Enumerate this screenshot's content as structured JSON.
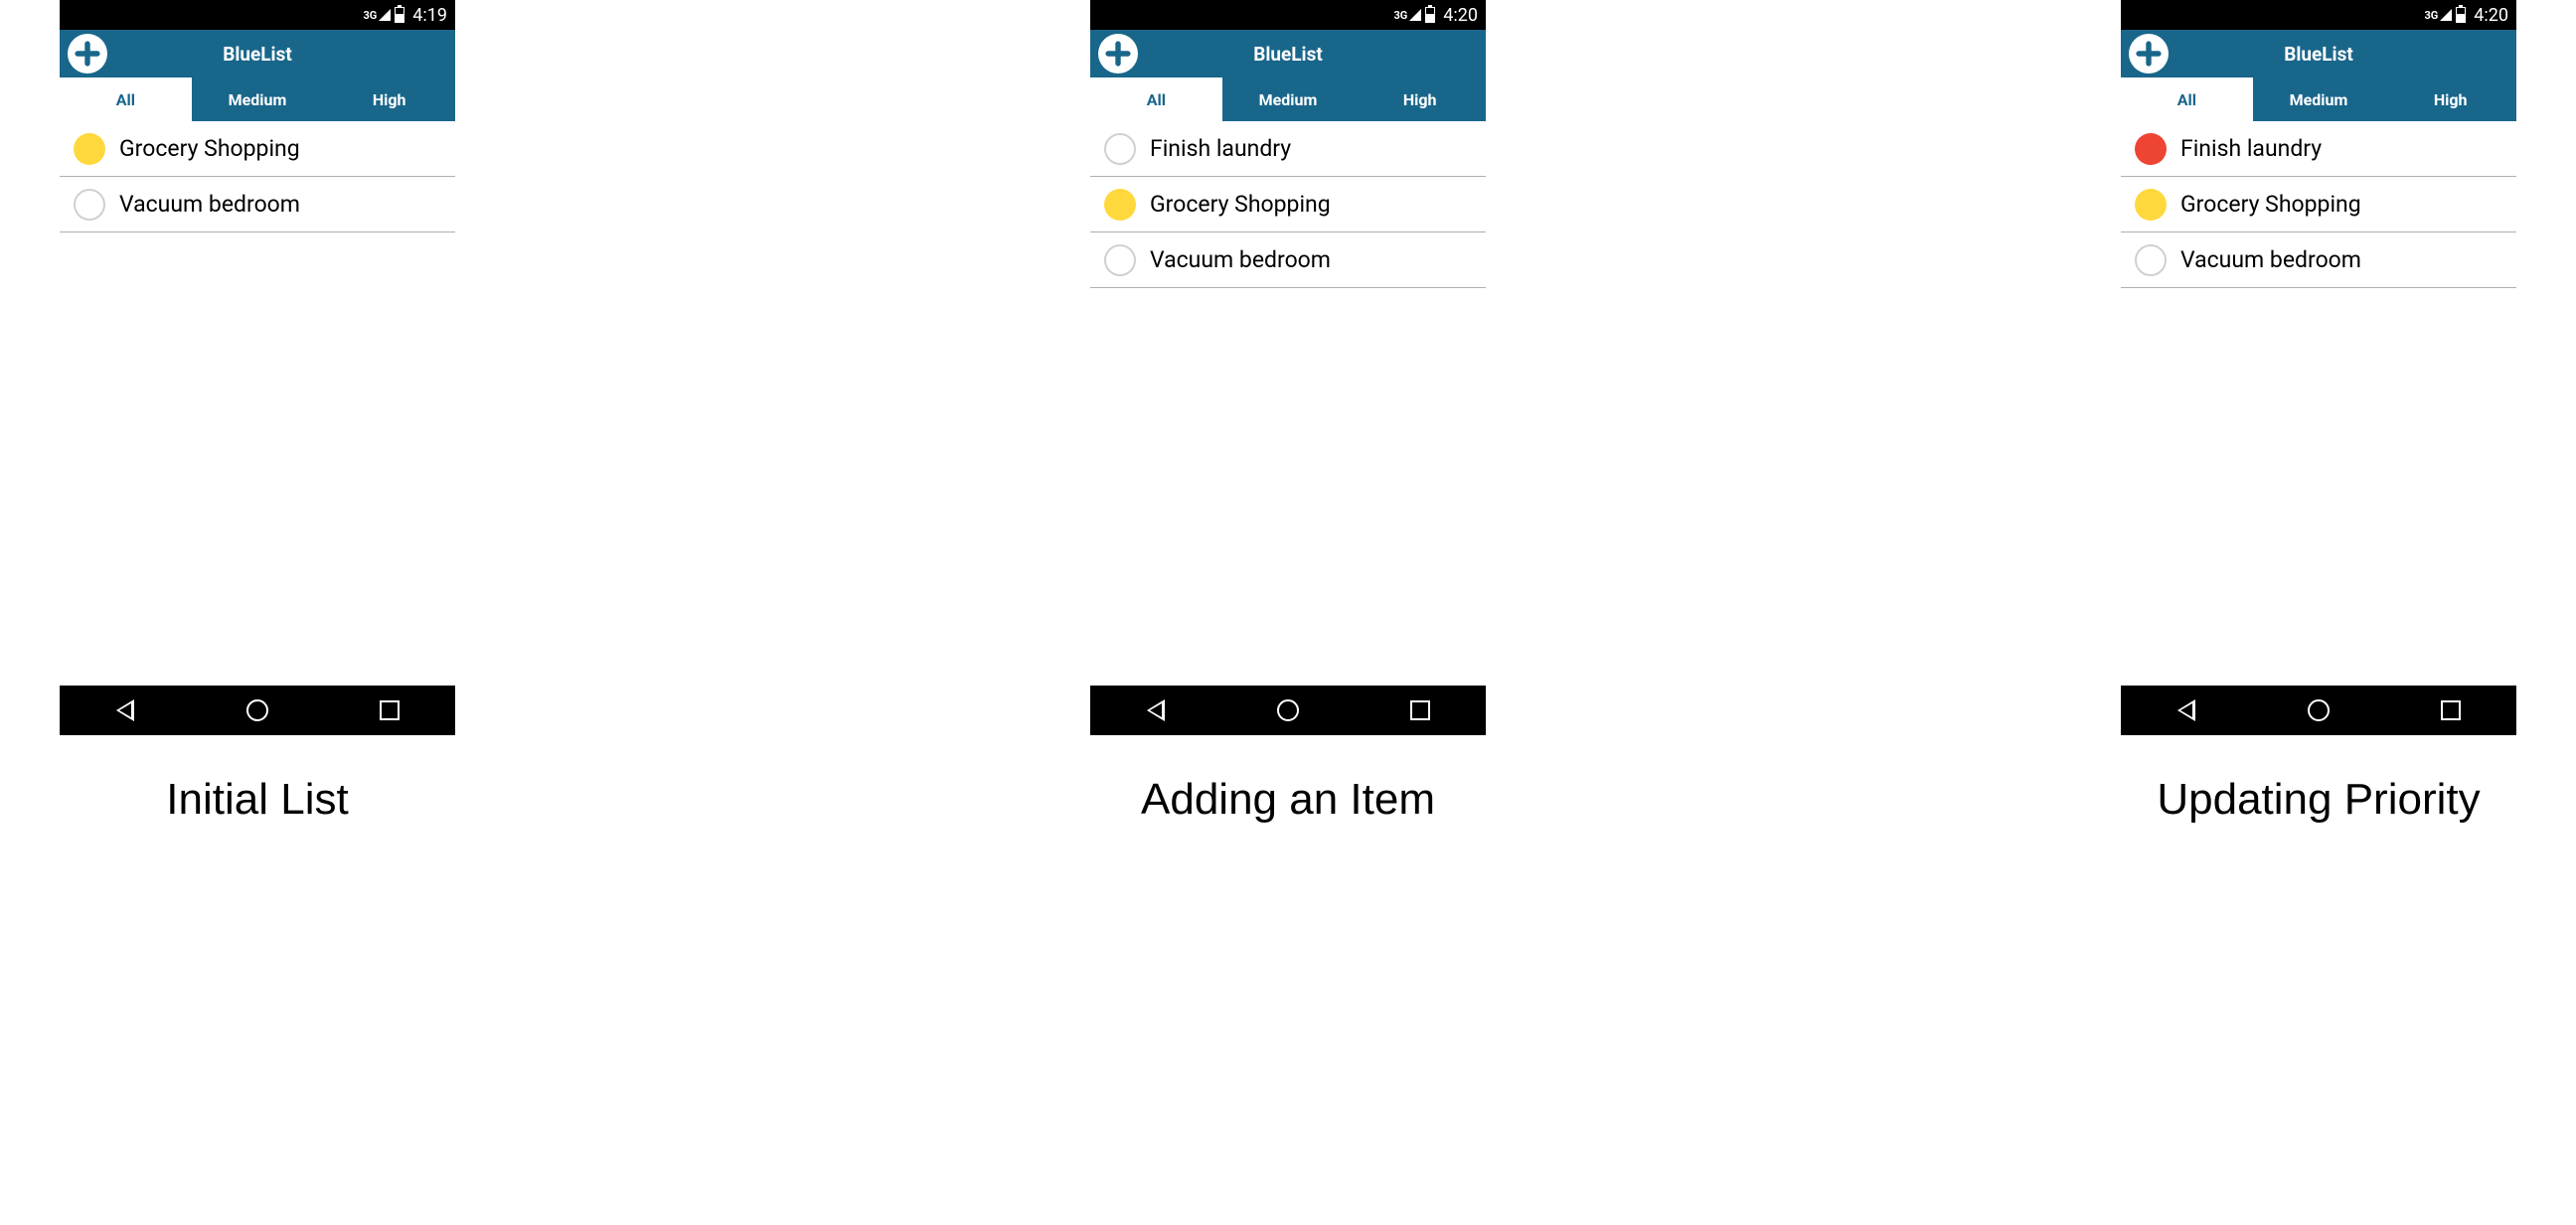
{
  "colors": {
    "brand": "#19668b",
    "priority_medium": "#ffd83d",
    "priority_high": "#ee4433"
  },
  "tabs": {
    "all": "All",
    "medium": "Medium",
    "high": "High"
  },
  "app_title": "BlueList",
  "status": {
    "network": "3G"
  },
  "screens": [
    {
      "caption": "Initial List",
      "clock": "4:19",
      "items": [
        {
          "text": "Grocery Shopping",
          "priority": "yellow"
        },
        {
          "text": "Vacuum bedroom",
          "priority": "none"
        }
      ]
    },
    {
      "caption": "Adding an Item",
      "clock": "4:20",
      "items": [
        {
          "text": "Finish laundry",
          "priority": "none"
        },
        {
          "text": "Grocery Shopping",
          "priority": "yellow"
        },
        {
          "text": "Vacuum bedroom",
          "priority": "none"
        }
      ]
    },
    {
      "caption": "Updating Priority",
      "clock": "4:20",
      "items": [
        {
          "text": "Finish laundry",
          "priority": "red"
        },
        {
          "text": "Grocery Shopping",
          "priority": "yellow"
        },
        {
          "text": "Vacuum bedroom",
          "priority": "none"
        }
      ]
    }
  ]
}
